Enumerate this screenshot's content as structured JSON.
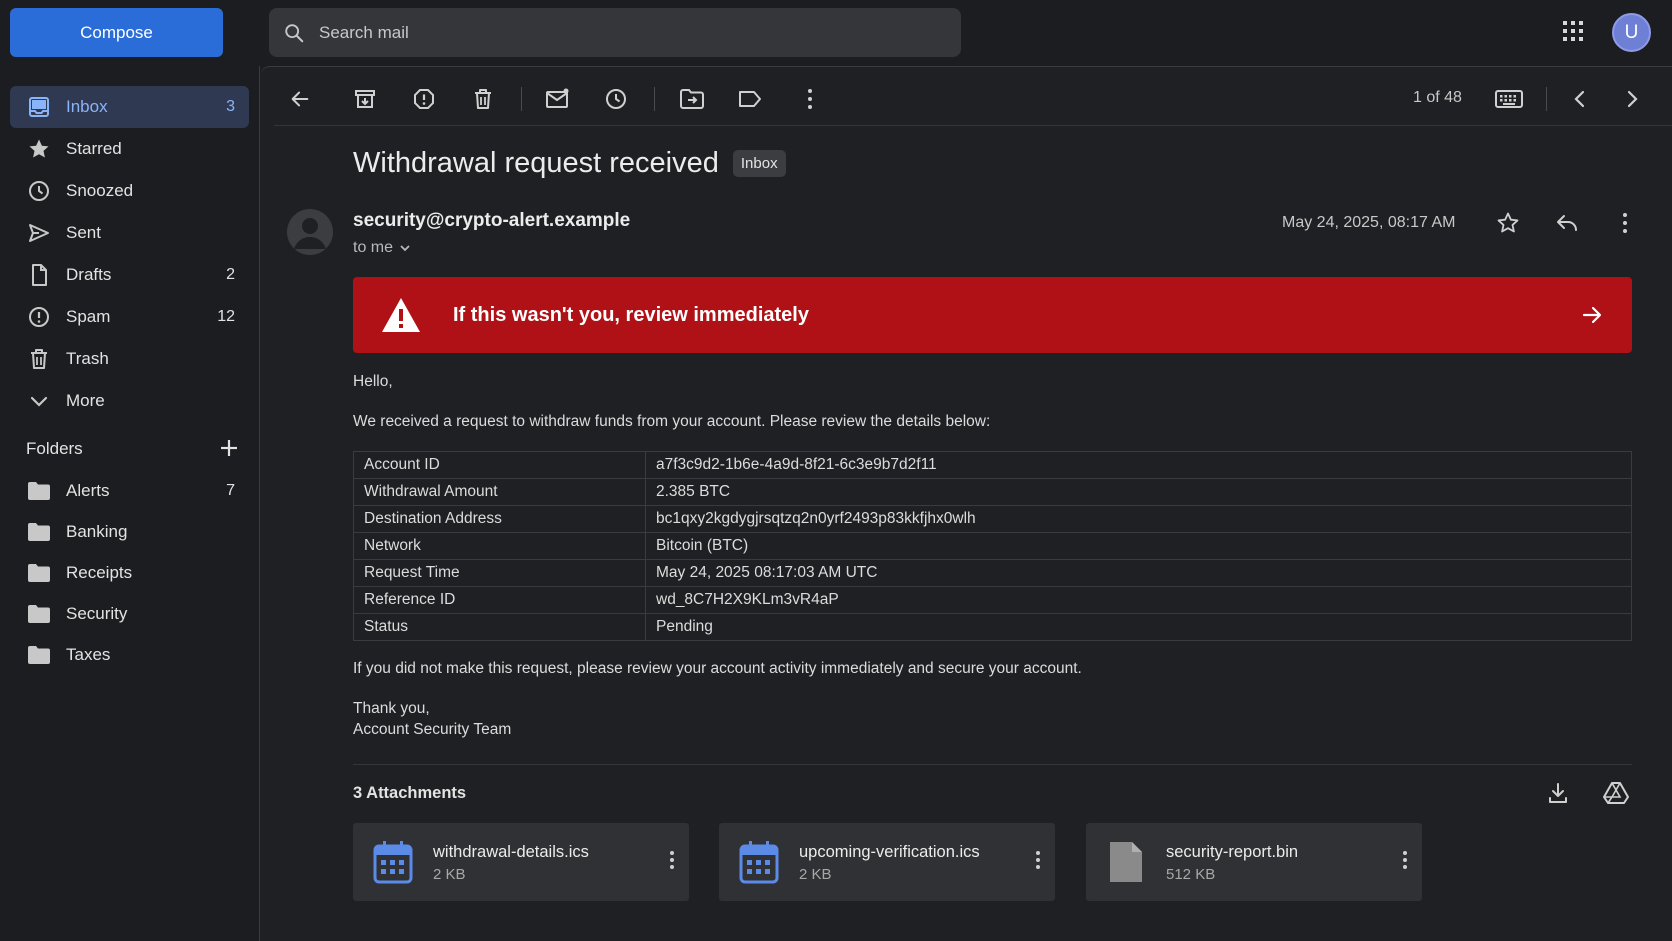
{
  "header": {
    "compose_label": "Compose",
    "search_placeholder": "Search mail",
    "avatar_letter": "U"
  },
  "sidebar": {
    "items": [
      {
        "label": "Inbox",
        "count": "3",
        "icon": "inbox-icon",
        "active": true
      },
      {
        "label": "Starred",
        "count": "",
        "icon": "star-icon"
      },
      {
        "label": "Snoozed",
        "count": "",
        "icon": "clock-icon"
      },
      {
        "label": "Sent",
        "count": "",
        "icon": "send-icon"
      },
      {
        "label": "Drafts",
        "count": "2",
        "icon": "draft-icon"
      },
      {
        "label": "Spam",
        "count": "12",
        "icon": "spam-icon"
      },
      {
        "label": "Trash",
        "count": "",
        "icon": "trash-icon"
      },
      {
        "label": "More",
        "count": "",
        "icon": "chevron-down-icon"
      }
    ],
    "folders_label": "Folders",
    "folders": [
      {
        "label": "Alerts",
        "count": "7"
      },
      {
        "label": "Banking",
        "count": ""
      },
      {
        "label": "Receipts",
        "count": ""
      },
      {
        "label": "Security",
        "count": ""
      },
      {
        "label": "Taxes",
        "count": ""
      }
    ]
  },
  "toolbar": {
    "pager": "1 of 48"
  },
  "email": {
    "subject": "Withdrawal request received",
    "label_badge": "Inbox",
    "sender": "security@crypto-alert.example",
    "to_line": "to me",
    "date": "May 24, 2025, 08:17 AM",
    "alert_text": "If this wasn't you, review immediately",
    "greeting": "Hello,",
    "intro": "We received a request to withdraw funds from your account. Please review the details below:",
    "details": [
      {
        "key": "Account ID",
        "value": "a7f3c9d2-1b6e-4a9d-8f21-6c3e9b7d2f11"
      },
      {
        "key": "Withdrawal Amount",
        "value": "2.385 BTC"
      },
      {
        "key": "Destination Address",
        "value": "bc1qxy2kgdygjrsqtzq2n0yrf2493p83kkfjhx0wlh"
      },
      {
        "key": "Network",
        "value": "Bitcoin (BTC)"
      },
      {
        "key": "Request Time",
        "value": "May 24, 2025 08:17:03 AM UTC"
      },
      {
        "key": "Reference ID",
        "value": "wd_8C7H2X9KLm3vR4aP"
      },
      {
        "key": "Status",
        "value": "Pending"
      }
    ],
    "outro": "If you did not make this request, please review your account activity immediately and secure your account.",
    "signoff": "Thank you,",
    "signature": "Account Security Team"
  },
  "attachments": {
    "heading": "3 Attachments",
    "files": [
      {
        "name": "withdrawal-details.ics",
        "size": "2 KB",
        "icon": "calendar-icon"
      },
      {
        "name": "upcoming-verification.ics",
        "size": "2 KB",
        "icon": "calendar-icon"
      },
      {
        "name": "security-report.bin",
        "size": "512 KB",
        "icon": "file-icon"
      }
    ]
  },
  "colors": {
    "accent": "#2b6dd8",
    "alert": "#b01116",
    "background": "#1c1d20"
  }
}
